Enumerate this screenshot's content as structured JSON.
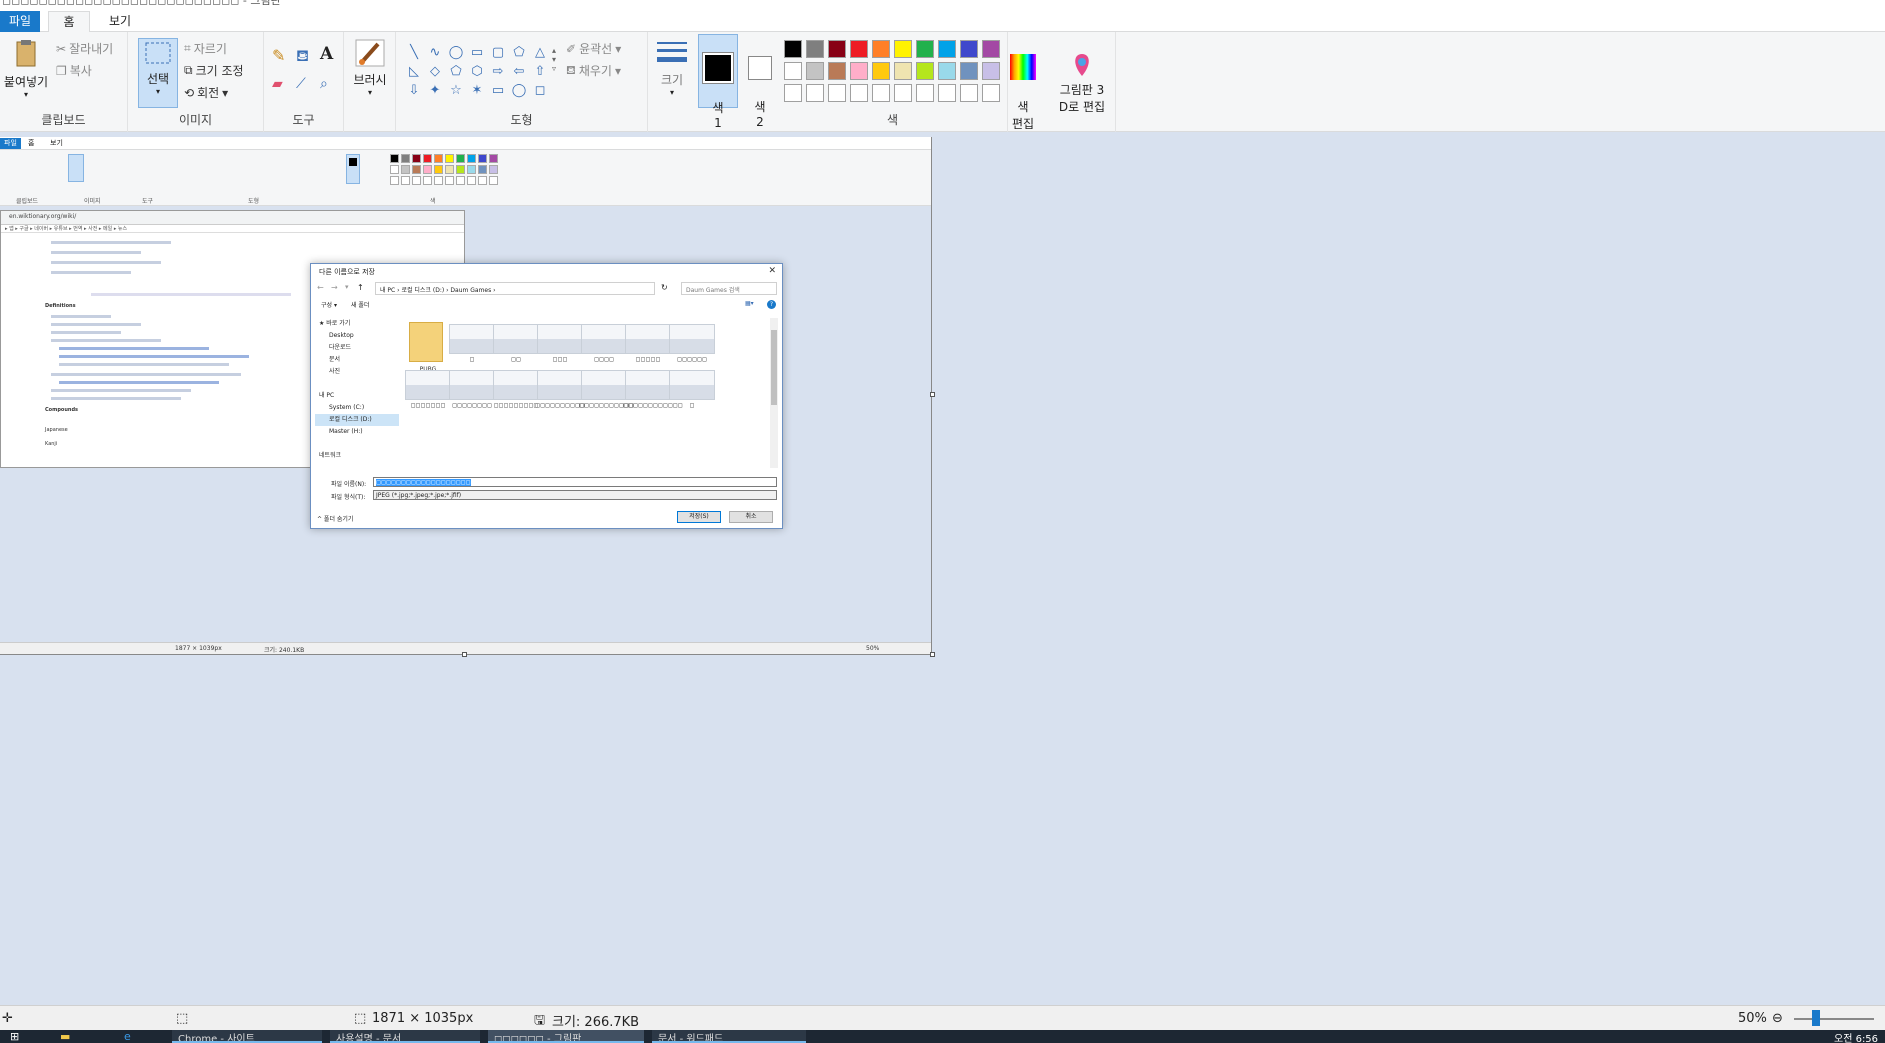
{
  "window": {
    "title_fragment": "◻◻◻◻◻◻◻◻◻◻◻◻◻◻◻◻◻◻◻◻◻◻◻◻◻◻ - 그림판"
  },
  "menu": {
    "file": "파일",
    "home": "홈",
    "view": "보기"
  },
  "ribbon": {
    "clipboard": {
      "paste": "붙여넣기",
      "cut": "잘라내기",
      "copy": "복사",
      "label": "클립보드"
    },
    "image": {
      "select": "선택",
      "crop": "자르기",
      "resize": "크기 조정",
      "rotate": "회전",
      "label": "이미지"
    },
    "tools": {
      "label": "도구"
    },
    "brush": {
      "label": "브러시"
    },
    "shapes": {
      "outline": "윤곽선",
      "fill": "채우기",
      "label": "도형",
      "glyphs": [
        "╲",
        "∿",
        "◯",
        "▭",
        "▢",
        "⬠",
        "△",
        "◺",
        "◇",
        "⬠",
        "⬡",
        "⇨",
        "⇦",
        "⇧",
        "⇩",
        "✦",
        "☆",
        "✶",
        "▭",
        "◯",
        "◻"
      ]
    },
    "size": {
      "label": "크기"
    },
    "color1": {
      "label": "색\n1"
    },
    "color2": {
      "label": "색\n2"
    },
    "edit_colors": {
      "label": "색\n편집"
    },
    "paint3d": {
      "label": "그림판 3\nD로 편집"
    },
    "colors_label": "색",
    "palette": [
      "#000000",
      "#7f7f7f",
      "#880015",
      "#ed1c24",
      "#ff7f27",
      "#fff200",
      "#22b14c",
      "#00a2e8",
      "#3f48cc",
      "#a349a4",
      "#ffffff",
      "#c3c3c3",
      "#b97a57",
      "#ffaec9",
      "#ffc90e",
      "#efe4b0",
      "#b5e61d",
      "#99d9ea",
      "#7092be",
      "#c8bfe7",
      "#ffffff",
      "#ffffff",
      "#ffffff",
      "#ffffff",
      "#ffffff",
      "#ffffff",
      "#ffffff",
      "#ffffff",
      "#ffffff",
      "#ffffff"
    ]
  },
  "nested": {
    "menu": {
      "file": "파일",
      "home": "홈",
      "view": "보기"
    },
    "labels": {
      "clipboard": "클립보드",
      "image": "이미지",
      "tools": "도구",
      "shapes": "도형",
      "colors": "색"
    },
    "status_dims": "1877 × 1039px",
    "status_size": "크기: 240.1KB",
    "zoom": "50%"
  },
  "browser": {
    "url": "en.wiktionary.org/wiki/",
    "bookmarks": "▸ 앱  ▸ 구글  ▸ 네이버  ▸ 유튜브  ▸ 번역  ▸ 사전  ▸ 메일  ▸ 뉴스",
    "definitions_heading": "Definitions",
    "compounds_heading": "Compounds",
    "japanese_heading": "Japanese",
    "kanji_heading": "Kanji"
  },
  "dialog": {
    "title": "다른 이름으로 저장",
    "close": "✕",
    "breadcrumb": "내 PC  ›  로컬 디스크 (D:)  ›  Daum Games  ›",
    "search_placeholder": "Daum Games 검색",
    "organize": "구성 ▾",
    "new_folder": "새 폴더",
    "nav": [
      "★ 바로 가기",
      "Desktop",
      "다운로드",
      "문서",
      "사진",
      "",
      "내 PC",
      "System (C:)",
      "로컬 디스크 (D:)",
      "Master (H:)",
      "",
      "네트워크"
    ],
    "folder_name": "PUBG",
    "file_labels": [
      "◻",
      "◻◻",
      "◻◻◻",
      "◻◻◻◻",
      "◻◻◻◻◻",
      "◻◻◻◻◻◻",
      "◻◻◻◻◻◻◻",
      "◻◻◻◻◻◻◻◻",
      "◻◻◻◻◻◻◻◻◻",
      "◻◻◻◻◻◻◻◻◻◻",
      "◻◻◻◻◻◻◻◻◻◻◻",
      "◻◻◻◻◻◻◻◻◻◻◻◻"
    ],
    "filename_label": "파일 이름(N):",
    "filename_value": "◻◻◻◻◻◻◻◻◻◻◻◻◻◻◻◻◻◻◻",
    "filetype_label": "파일 형식(T):",
    "filetype_value": "JPEG (*.jpg;*.jpeg;*.jpe;*.jfif)",
    "hide_folders": "^ 폴더 숨기기",
    "save": "저장(S)",
    "cancel": "취소"
  },
  "status": {
    "dimensions": "1871 × 1035px",
    "size": "크기: 266.7KB",
    "zoom": "50%"
  },
  "taskbar": {
    "items": [
      "Chrome - 사이트",
      "사용설명 - 문서",
      "◻◻◻◻◻◻ - 그림판",
      "문서 - 워드패드"
    ],
    "clock": "오전 6:56"
  }
}
